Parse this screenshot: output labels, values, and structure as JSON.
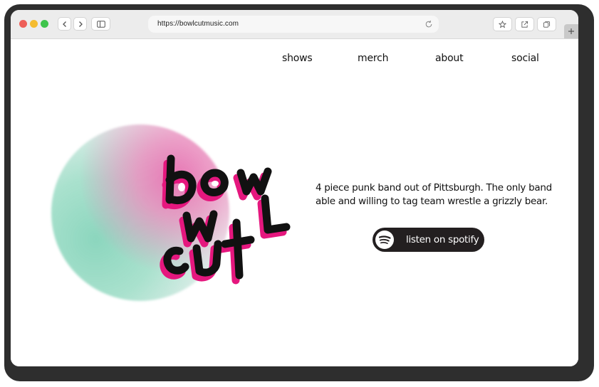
{
  "browser": {
    "url": "https://bowlcutmusic.com"
  },
  "nav": {
    "items": [
      {
        "label": "shows"
      },
      {
        "label": "merch"
      },
      {
        "label": "about"
      },
      {
        "label": "social"
      }
    ]
  },
  "hero": {
    "logo_text": "bowl cut",
    "tagline": "4 piece punk band out of Pittsburgh. The only band able and willing to tag team wrestle a grizzly bear.",
    "cta_label": "listen on spotify"
  },
  "colors": {
    "accent_pink": "#e5177e",
    "logo_black": "#111111",
    "button_dark": "#231f20",
    "blob_pink": "#e970b2",
    "blob_mint": "#8cd6be"
  },
  "icons": {
    "back": "chevron-left-icon",
    "forward": "chevron-right-icon",
    "sidebar": "sidebar-icon",
    "reload": "reload-icon",
    "bookmark": "star-icon",
    "share": "share-icon",
    "tabs": "tabs-icon",
    "new_tab": "plus-icon",
    "spotify": "spotify-icon"
  }
}
